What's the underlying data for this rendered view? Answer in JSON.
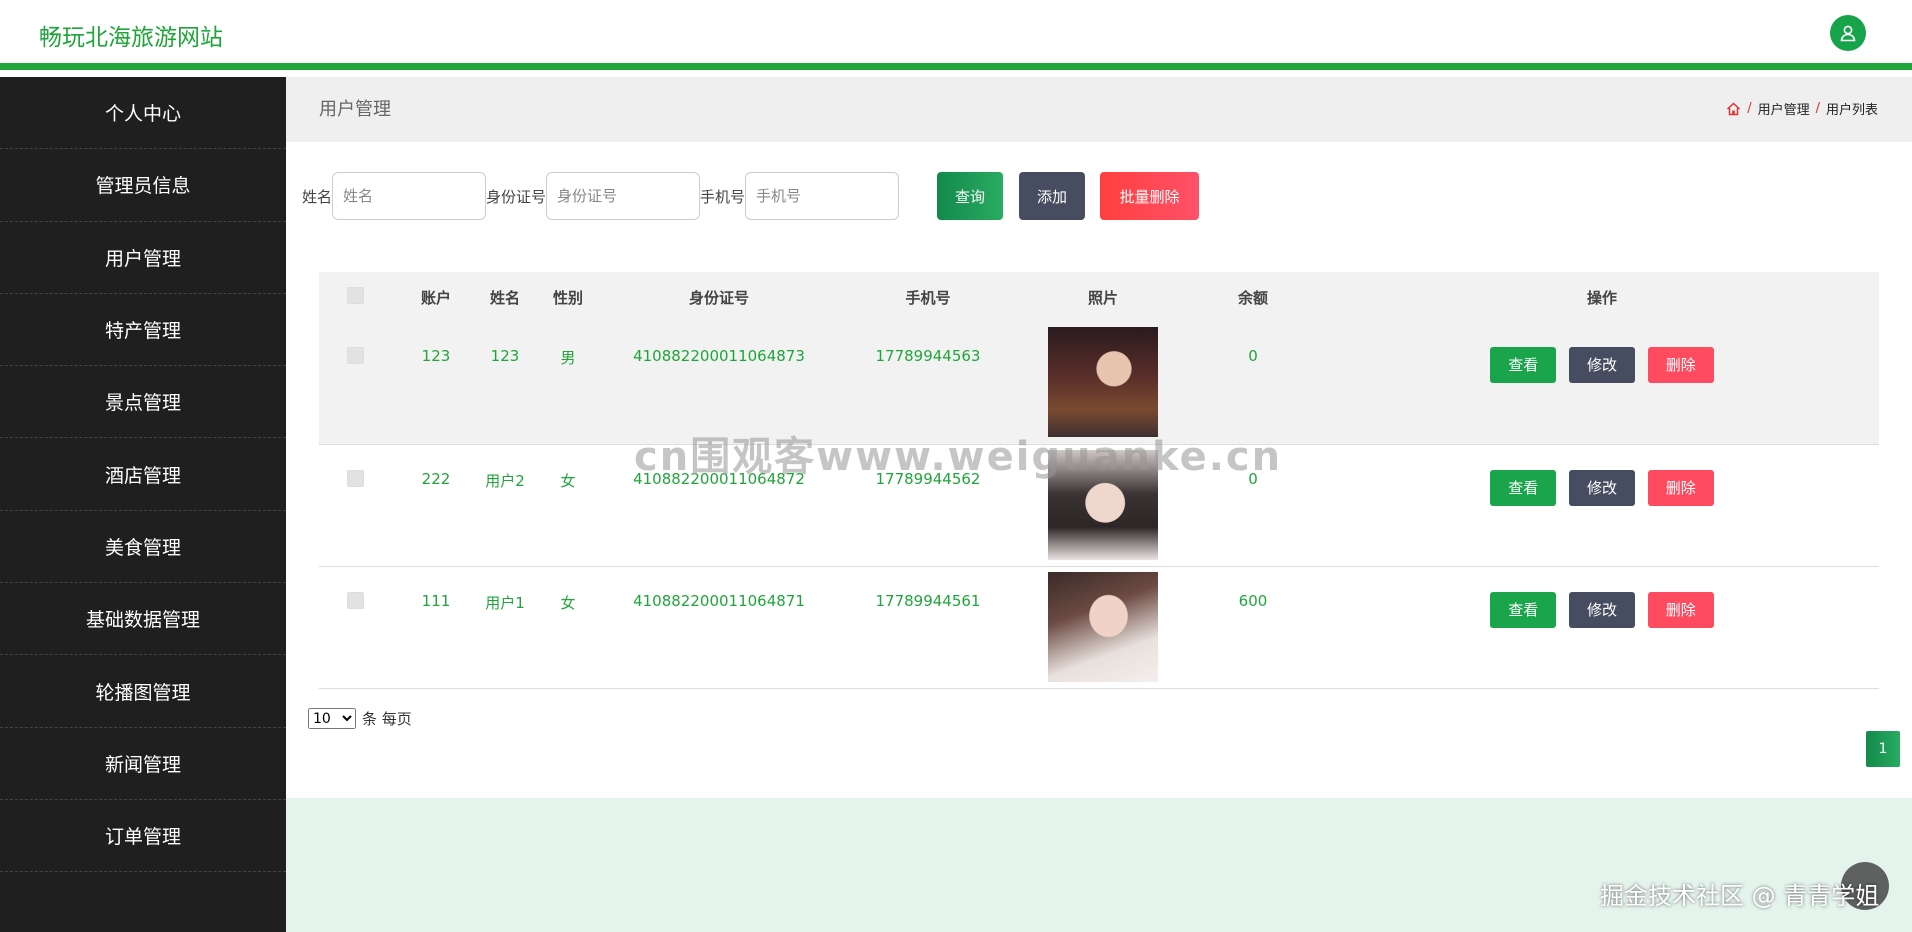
{
  "header": {
    "site_title": "畅玩北海旅游网站",
    "user_icon": "user-icon"
  },
  "sidebar": {
    "items": [
      {
        "label": "个人中心"
      },
      {
        "label": "管理员信息"
      },
      {
        "label": "用户管理"
      },
      {
        "label": "特产管理"
      },
      {
        "label": "景点管理"
      },
      {
        "label": "酒店管理"
      },
      {
        "label": "美食管理"
      },
      {
        "label": "基础数据管理"
      },
      {
        "label": "轮播图管理"
      },
      {
        "label": "新闻管理"
      },
      {
        "label": "订单管理"
      }
    ]
  },
  "page": {
    "title": "用户管理",
    "breadcrumb": {
      "home_icon": "home-icon",
      "level1": "用户管理",
      "level2": "用户列表",
      "separator": "/"
    }
  },
  "search": {
    "name_label": "姓名",
    "name_placeholder": "姓名",
    "id_label": "身份证号",
    "id_placeholder": "身份证号",
    "phone_label": "手机号",
    "phone_placeholder": "手机号",
    "query_btn": "查询",
    "add_btn": "添加",
    "batch_delete_btn": "批量删除"
  },
  "table": {
    "headers": [
      "账户",
      "姓名",
      "性别",
      "身份证号",
      "手机号",
      "照片",
      "余额",
      "操作"
    ],
    "rows": [
      {
        "account": "123",
        "name": "123",
        "gender": "男",
        "id_number": "410882200011064873",
        "phone": "17789944563",
        "balance": "0"
      },
      {
        "account": "222",
        "name": "用户2",
        "gender": "女",
        "id_number": "410882200011064872",
        "phone": "17789944562",
        "balance": "0"
      },
      {
        "account": "111",
        "name": "用户1",
        "gender": "女",
        "id_number": "410882200011064871",
        "phone": "17789944561",
        "balance": "600"
      }
    ],
    "actions": {
      "view": "查看",
      "edit": "修改",
      "delete": "删除"
    }
  },
  "pagination": {
    "page_size": "10",
    "page_size_suffix": "条 每页",
    "current_page": "1"
  },
  "watermarks": {
    "center": "cn围观客www.weiguanke.cn",
    "corner": "掘金技术社区 @ 青青学姐"
  },
  "colors": {
    "brand_green": "#20a53a",
    "sidebar_bg": "#1f1f1f",
    "edit_btn": "#474d61",
    "delete_btn": "#ff4b5f"
  }
}
